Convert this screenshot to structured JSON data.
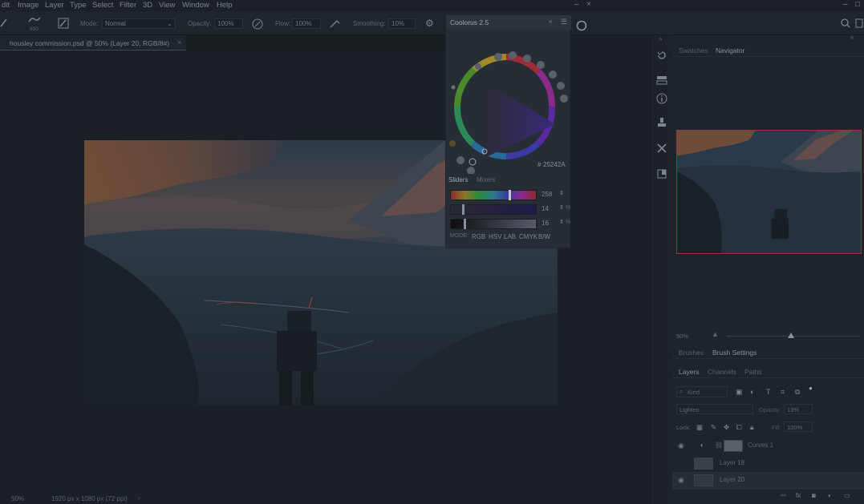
{
  "menu": {
    "items": [
      "dit",
      "Image",
      "Layer",
      "Type",
      "Select",
      "Filter",
      "3D",
      "View",
      "Window",
      "Help"
    ]
  },
  "options": {
    "brush_size": "650",
    "mode_label": "Mode:",
    "mode_value": "Normal",
    "opacity_label": "Opacity:",
    "opacity_value": "100%",
    "flow_label": "Flow:",
    "flow_value": "100%",
    "smoothing_label": "Smoothing:",
    "smoothing_value": "10%"
  },
  "document": {
    "tab_title": "housley commission.psd @ 50% (Layer 20, RGB/8#)",
    "tab_close": "×"
  },
  "status": {
    "zoom": "50%",
    "doc_size": "1920 px x 1080 px (72 ppi)",
    "arrow": "›"
  },
  "coolorus": {
    "title": "Coolorus 2.5",
    "hex": "25242A",
    "tab_sliders": "Sliders",
    "tab_mixers": "Mixers",
    "sliders": [
      {
        "prefix": "H",
        "value": "258",
        "unit": ""
      },
      {
        "prefix": "S",
        "value": "14",
        "unit": "%"
      },
      {
        "prefix": "B",
        "value": "16",
        "unit": "%"
      }
    ],
    "mode_label": "MODE:",
    "modes": [
      "RGB",
      "HSV",
      "LAB",
      "CMYK",
      "B/W"
    ],
    "current_color": "#25242a",
    "hue_position": 0.71,
    "sat_position": 0.14,
    "bri_position": 0.16
  },
  "panels": {
    "top_tabs": [
      "Swatches",
      "Navigator"
    ],
    "navigator_zoom": "50%",
    "navigator_slider_position": 0.55,
    "brush_tabs": [
      "Brushes",
      "Brush Settings"
    ],
    "layer_tabs": [
      "Layers",
      "Channels",
      "Paths"
    ],
    "filter_kind": "Kind",
    "blend_mode": "Lighten",
    "opacity_label": "Opacity:",
    "opacity_value": "13%",
    "lock_label": "Lock:",
    "fill_label": "Fill:",
    "fill_value": "100%",
    "layers": [
      {
        "name": "Curves 1",
        "visible": true,
        "type": "adjustment"
      },
      {
        "name": "Layer 18",
        "visible": false,
        "type": "pixel"
      },
      {
        "name": "Layer 20",
        "visible": true,
        "type": "pixel",
        "selected": true
      }
    ]
  },
  "colors": {
    "accent_red": "#b23a3a",
    "panel_bg": "#1d242a",
    "canvas_bg": "#1a2026"
  }
}
